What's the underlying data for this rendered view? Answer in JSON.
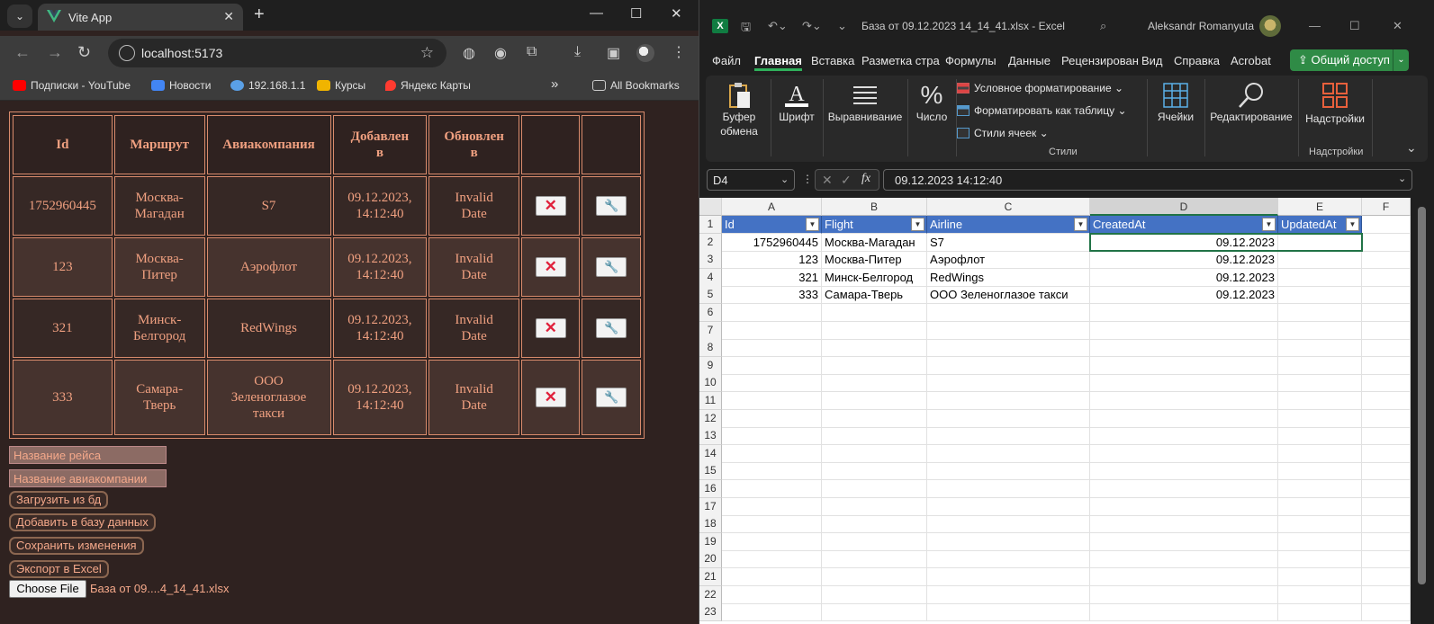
{
  "browser": {
    "tab_title": "Vite App",
    "url": "localhost:5173",
    "bookmarks": [
      {
        "label": "Подписки - YouTube",
        "icon": "youtube-icon",
        "color": "#ff0000"
      },
      {
        "label": "Новости",
        "icon": "news-icon",
        "color": "#4285f4"
      },
      {
        "label": "192.168.1.1",
        "icon": "router-icon",
        "color": "#5aa0e6"
      },
      {
        "label": "Курсы",
        "icon": "courses-icon",
        "color": "#f0b400"
      },
      {
        "label": "Яндекс Карты",
        "icon": "map-pin-icon",
        "color": "#ff3b30"
      }
    ],
    "more_bookmarks": "»",
    "all_bookmarks": "All Bookmarks"
  },
  "flights_table": {
    "headers": [
      "Id",
      "Маршрут",
      "Авиакомпания",
      "Добавлен в",
      "Обновлен в",
      "",
      ""
    ],
    "rows": [
      {
        "id": "1752960445",
        "route": "Москва-Магадан",
        "airline": "S7",
        "created": "09.12.2023, 14:12:40",
        "updated": "Invalid Date"
      },
      {
        "id": "123",
        "route": "Москва-Питер",
        "airline": "Аэрофлот",
        "created": "09.12.2023, 14:12:40",
        "updated": "Invalid Date"
      },
      {
        "id": "321",
        "route": "Минск-Белгород",
        "airline": "RedWings",
        "created": "09.12.2023, 14:12:40",
        "updated": "Invalid Date"
      },
      {
        "id": "333",
        "route": "Самара-Тверь",
        "airline": "ООО Зеленоглазое такси",
        "created": "09.12.2023, 14:12:40",
        "updated": "Invalid Date"
      }
    ],
    "delete_label": "✕",
    "edit_label": "🔧"
  },
  "form": {
    "flight_placeholder": "Название рейса",
    "airline_placeholder": "Название авиакомпании",
    "load_label": "Загрузить из бд",
    "add_label": "Добавить в базу данных",
    "save_label": "Сохранить изменения",
    "export_label": "Экспорт в Excel",
    "choose_file_label": "Choose File",
    "file_name": "База от 09....4_14_41.xlsx"
  },
  "excel": {
    "file_title": "База от 09.12.2023 14_14_41.xlsx  -  Excel",
    "user_name": "Aleksandr Romanyuta",
    "menu": [
      "Файл",
      "Главная",
      "Вставка",
      "Разметка стра",
      "Формулы",
      "Данные",
      "Рецензирован",
      "Вид",
      "Справка",
      "Acrobat"
    ],
    "active_menu": "Главная",
    "share_label": "Общий доступ",
    "ribbon": {
      "clipboard": "Буфер обмена",
      "font": "Шрифт",
      "alignment": "Выравнивание",
      "number": "Число",
      "cond_format": "Условное форматирование",
      "format_table": "Форматировать как таблицу",
      "cell_styles": "Стили ячеек",
      "styles_group": "Стили",
      "cells": "Ячейки",
      "editing": "Редактирование",
      "addins": "Надстройки",
      "addins_group": "Надстройки"
    },
    "name_box": "D4",
    "formula": "09.12.2023  14:12:40",
    "columns": [
      "A",
      "B",
      "C",
      "D",
      "E",
      "F"
    ],
    "header_row": [
      "Id",
      "Flight",
      "Airline",
      "CreatedAt",
      "UpdatedAt"
    ],
    "rows": [
      [
        "1752960445",
        "Москва-Магадан",
        "S7",
        "09.12.2023",
        ""
      ],
      [
        "123",
        "Москва-Питер",
        "Аэрофлот",
        "09.12.2023",
        ""
      ],
      [
        "321",
        "Минск-Белгород",
        "RedWings",
        "09.12.2023",
        ""
      ],
      [
        "333",
        "Самара-Тверь",
        "ООО Зеленоглазое такси",
        "09.12.2023",
        ""
      ]
    ],
    "row_numbers": [
      "1",
      "2",
      "3",
      "4",
      "5",
      "6",
      "7",
      "8",
      "9",
      "10",
      "11",
      "12",
      "13",
      "14",
      "15",
      "16",
      "17",
      "18",
      "19",
      "20",
      "21",
      "22",
      "23"
    ]
  }
}
